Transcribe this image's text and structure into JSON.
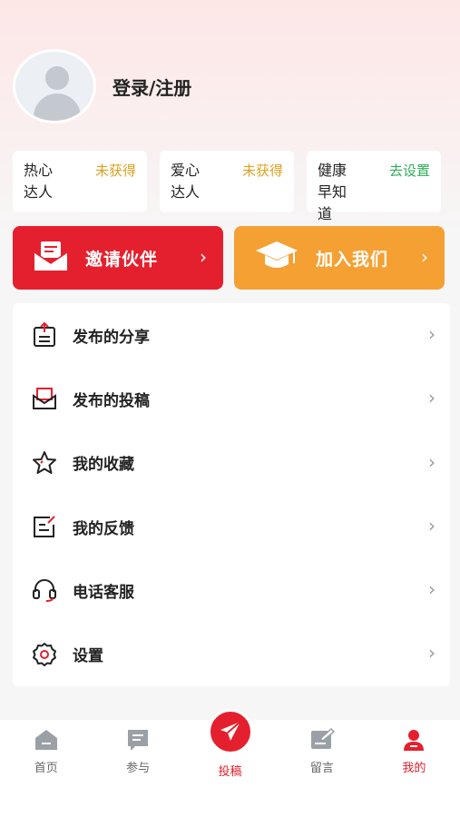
{
  "profile": {
    "login_label": "登录/注册"
  },
  "badges": [
    {
      "name": "热心达人",
      "status": "未获得"
    },
    {
      "name": "爱心达人",
      "status": "未获得"
    },
    {
      "name": "健康早知道",
      "status": "去设置"
    }
  ],
  "actions": {
    "invite": "邀请伙伴",
    "join": "加入我们",
    "chevron": "›"
  },
  "menu": [
    {
      "label": "发布的分享",
      "icon": "share-upload-icon"
    },
    {
      "label": "发布的投稿",
      "icon": "envelope-icon"
    },
    {
      "label": "我的收藏",
      "icon": "star-icon"
    },
    {
      "label": "我的反馈",
      "icon": "feedback-icon"
    },
    {
      "label": "电话客服",
      "icon": "headset-icon"
    },
    {
      "label": "设置",
      "icon": "gear-icon"
    }
  ],
  "menu_chevron": "›",
  "tabs": [
    {
      "label": "首页",
      "icon": "home-icon"
    },
    {
      "label": "参与",
      "icon": "chat-icon"
    },
    {
      "label": "投稿",
      "icon": "paper-plane-icon"
    },
    {
      "label": "留言",
      "icon": "message-edit-icon"
    },
    {
      "label": "我的",
      "icon": "user-icon"
    }
  ],
  "colors": {
    "accent": "#e5202e",
    "orange": "#f5a033",
    "gold": "#e0a020",
    "green": "#2fae5a"
  }
}
